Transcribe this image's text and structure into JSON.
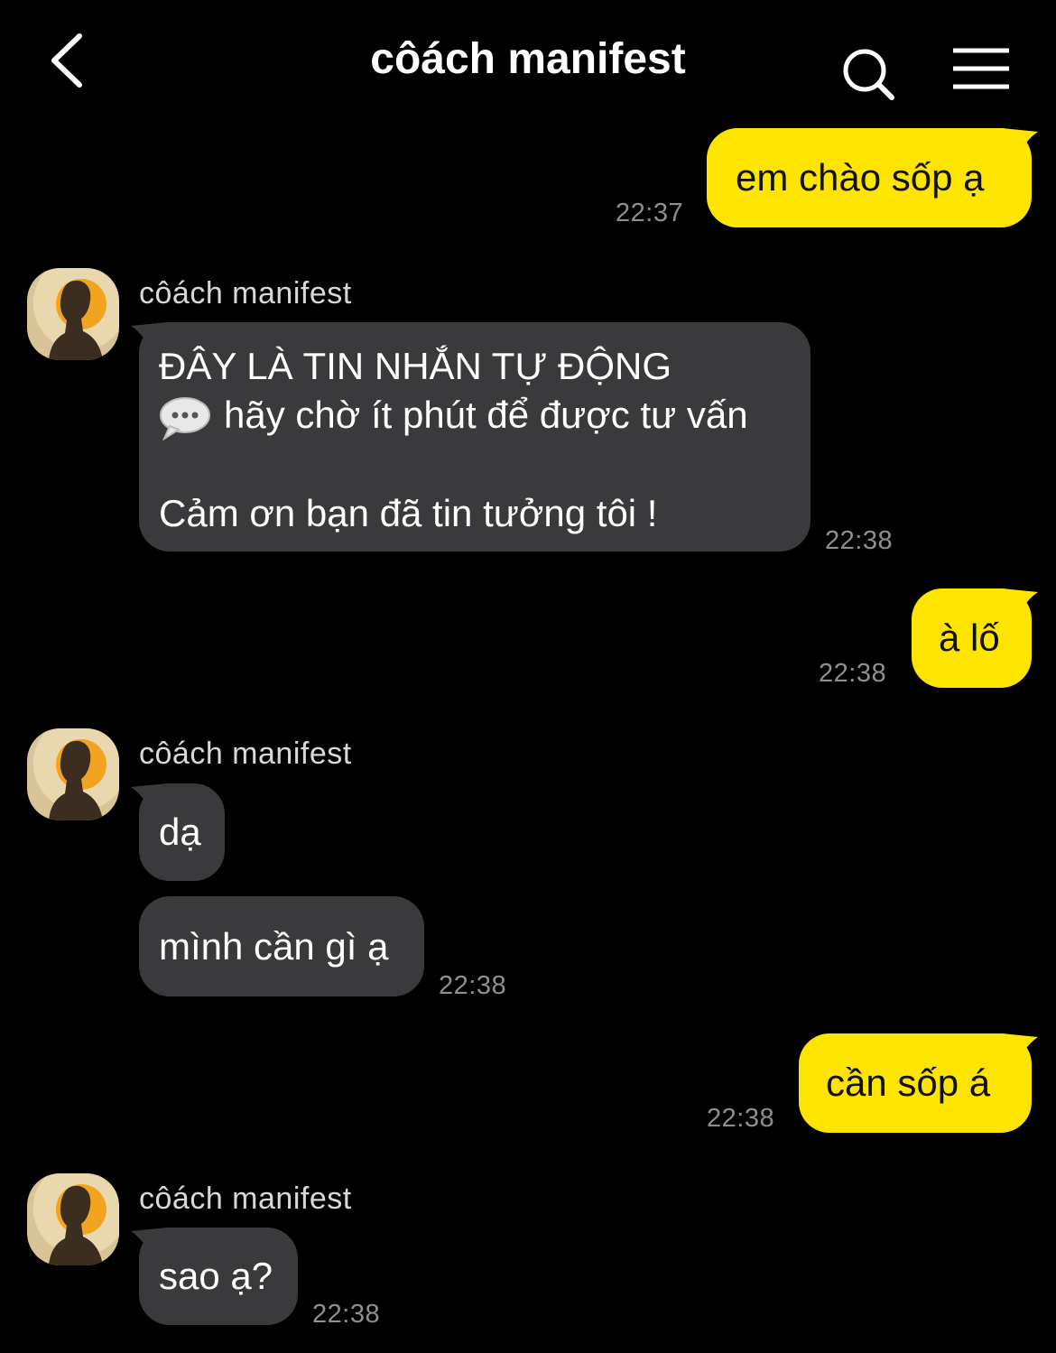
{
  "header": {
    "title": "côách manifest",
    "back_icon": "chevron-left-icon",
    "search_icon": "search-icon",
    "menu_icon": "hamburger-menu-icon"
  },
  "colors": {
    "background": "#000000",
    "outgoing_bubble": "#FEE500",
    "incoming_bubble": "#3a3a3c",
    "timestamp": "#8e8e93"
  },
  "messages": [
    {
      "direction": "out",
      "text": "em chào sốp ạ",
      "time": "22:37"
    },
    {
      "direction": "in",
      "sender": "côách manifest",
      "lines": [
        "ĐÂY LÀ TIN NHẮN TỰ ĐỘNG",
        "hãy chờ ít phút để được tư vấn",
        "",
        "Cảm ơn bạn đã tin tưởng tôi !"
      ],
      "time": "22:38"
    },
    {
      "direction": "out",
      "text": "à lố",
      "time": "22:38"
    },
    {
      "direction": "in",
      "sender": "côách manifest",
      "text": "dạ"
    },
    {
      "direction": "in",
      "text": "mình cần gì ạ",
      "time": "22:38"
    },
    {
      "direction": "out",
      "text": "cần sốp á",
      "time": "22:38"
    },
    {
      "direction": "in",
      "sender": "côách manifest",
      "text": "sao ạ?",
      "time": "22:38"
    }
  ]
}
